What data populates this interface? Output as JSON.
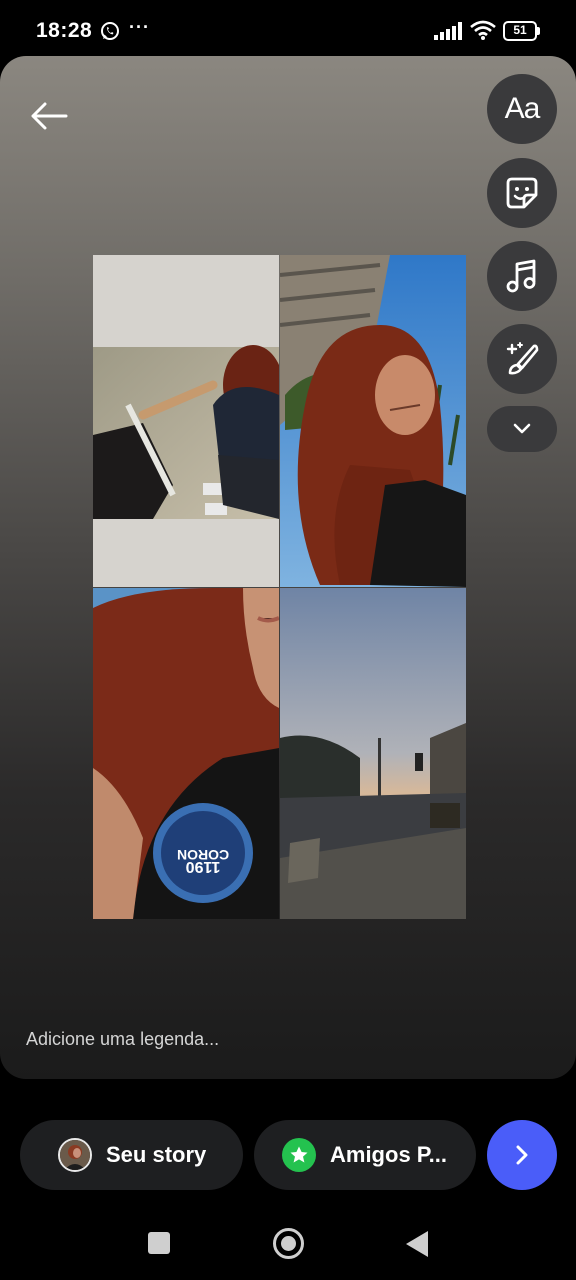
{
  "status_bar": {
    "time": "18:28",
    "notification_icons": [
      "whatsapp-icon",
      "more-dots-icon"
    ],
    "more_indicator": "···",
    "battery_level": "51",
    "system_icons": [
      "signal-icon",
      "wifi-icon",
      "battery-icon"
    ]
  },
  "editor": {
    "back_icon": "arrow-left-icon",
    "tools": [
      {
        "name": "text-tool",
        "label": "Aa",
        "icon": "text-icon"
      },
      {
        "name": "sticker-tool",
        "icon": "sticker-icon"
      },
      {
        "name": "music-tool",
        "icon": "music-note-icon"
      },
      {
        "name": "effects-tool",
        "icon": "magic-brush-icon"
      },
      {
        "name": "more-tools",
        "icon": "chevron-down-icon"
      }
    ],
    "collage": {
      "layout": "2x2 grid",
      "photos": [
        {
          "position": "top-left",
          "subject": "woman with curly red hair holding umbrella, viewed from above"
        },
        {
          "position": "top-right",
          "subject": "woman with curly red hair selfie, building and blue sky"
        },
        {
          "position": "bottom-left",
          "subject": "close-up curly red hair, black t-shirt with round badge"
        },
        {
          "position": "bottom-right",
          "subject": "street at dusk with traffic light"
        }
      ]
    },
    "caption_placeholder": "Adicione uma legenda..."
  },
  "share": {
    "your_story_label": "Seu story",
    "close_friends_label": "Amigos P...",
    "next_icon": "chevron-right-icon",
    "colors": {
      "next_button": "#4a5df9",
      "close_friends_badge": "#24c24f"
    }
  },
  "nav_bar": {
    "buttons": [
      "recents-button",
      "home-button",
      "back-button"
    ]
  }
}
